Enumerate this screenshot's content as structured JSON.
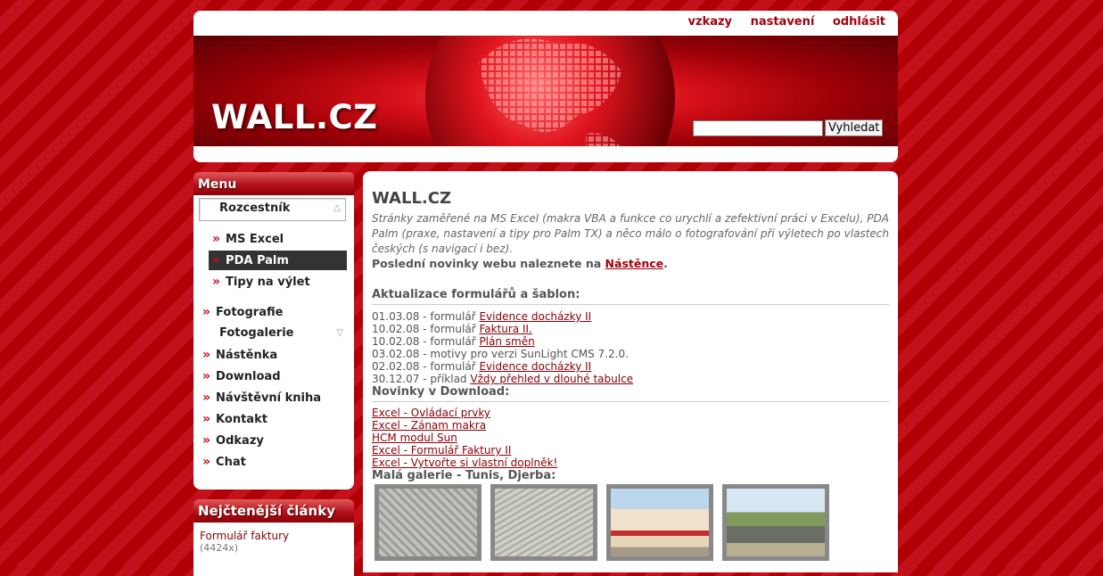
{
  "top_links": {
    "messages": "vzkazy",
    "settings": "nastavení",
    "logout": "odhlásit"
  },
  "site_title": "WALL.CZ",
  "search": {
    "button": "Vyhledat",
    "value": ""
  },
  "menu": {
    "title": "Menu",
    "dropdown": "Rozcestník",
    "sub_items": [
      "MS Excel",
      "PDA Palm",
      "Tipy na výlet"
    ],
    "items": [
      "Fotografie",
      "Fotogalerie",
      "Nástěnka",
      "Download",
      "Návštěvní kniha",
      "Kontakt",
      "Odkazy",
      "Chat"
    ]
  },
  "popular": {
    "title": "Nejčtenější články",
    "item_label": "Formulář faktury",
    "item_count": "(4424x)"
  },
  "content": {
    "title": "WALL.CZ",
    "intro": "Stránky zaměřené na MS Excel (makra VBA a funkce co urychlí a zefektivní práci v Excelu), PDA Palm (praxe, nastavení a tipy pro Palm TX) a něco málo o fotografování při výletech po vlastech českých (s navigací i bez).",
    "news_prefix": "Poslední novinky webu naleznete na",
    "news_link": "Nástěnce",
    "news_suffix": ".",
    "updates_title": "Aktualizace formulářů a šablon:",
    "updates": [
      {
        "prefix": "01.03.08 - formulář",
        "link": "Evidence docházky II"
      },
      {
        "prefix": "10.02.08 - formulář",
        "link": "Faktura II."
      },
      {
        "prefix": "10.02.08 - formulář",
        "link": "Plán směn"
      },
      {
        "prefix": "03.02.08 - motivy pro verzi SunLight CMS 7.2.0.",
        "link": ""
      },
      {
        "prefix": "02.02.08 - formulář",
        "link": "Evidence docházky II"
      },
      {
        "prefix": "30.12.07 - příklad",
        "link": "Vždy přehled v dlouhé tabulce"
      }
    ],
    "downloads_title": "Novinky v Download:",
    "downloads": [
      "Excel - Ovládací prvky",
      "Excel - Zánam makra",
      "HCM modul Sun",
      "Excel - Formulář Faktury II",
      "Excel - Vytvořte si vlastní doplněk!"
    ],
    "gallery_title": "Malá galerie - Tunis, Djerba:"
  }
}
